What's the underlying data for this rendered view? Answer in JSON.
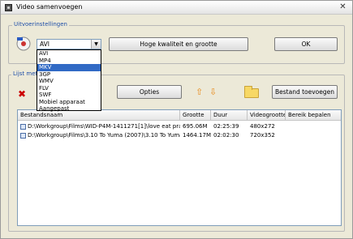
{
  "window": {
    "title": "Video samenvoegen",
    "close_glyph": "✕"
  },
  "output_settings": {
    "group_label": "Uitvoerinstellingen",
    "format_selected": "AVI",
    "dropdown_options": [
      "AVI",
      "MP4",
      "MKV",
      "3GP",
      "WMV",
      "FLV",
      "SWF",
      "Mobiel apparaat",
      "Aangepast"
    ],
    "dropdown_highlighted": "MKV",
    "quality_button": "Hoge kwaliteit en grootte",
    "ok_button": "OK"
  },
  "file_list": {
    "group_label": "Lijst met b",
    "options_button": "Opties",
    "add_file_button": "Bestand toevoegen",
    "columns": [
      "Bestandsnaam",
      "Grootte",
      "Duur",
      "Videogrootte",
      "Bereik bepalen"
    ],
    "rows": [
      {
        "name": "D:\\Workgroup\\Films\\WID-P4M-1411271[1]\\love eat pra...",
        "size": "695.06M",
        "duration": "02:25:39",
        "video_size": "480x272",
        "range": ""
      },
      {
        "name": "D:\\Workgroup\\Films\\3.10 To Yuma (2007)\\3.10 To Yuma...",
        "size": "1464.17M",
        "duration": "02:02:30",
        "video_size": "720x352",
        "range": ""
      }
    ]
  },
  "icons": {
    "format": "format-icon",
    "delete": "delete-icon",
    "up": "move-up-icon",
    "down": "move-down-icon",
    "folder": "folder-icon"
  },
  "colors": {
    "accent": "#316ac5",
    "group_label": "#1f4fa8",
    "delete": "#cc0000",
    "arrows": "#e88b1a"
  }
}
